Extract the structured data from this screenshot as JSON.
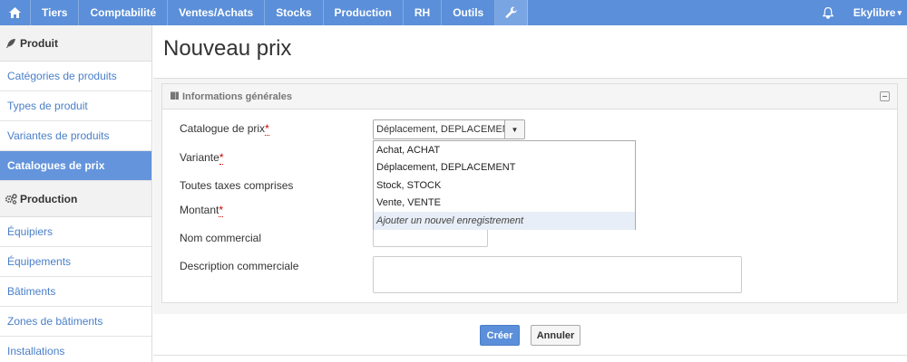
{
  "nav": {
    "home_icon": "home-icon",
    "items": [
      "Tiers",
      "Comptabilité",
      "Ventes/Achats",
      "Stocks",
      "Production",
      "RH",
      "Outils"
    ],
    "settings_icon": "wrench-icon",
    "bell_icon": "bell-icon",
    "user": "Ekylibre",
    "user_caret": "▾"
  },
  "sidebar": {
    "sections": [
      {
        "title": "Produit",
        "icon": "feather-icon",
        "items": [
          "Catégories de produits",
          "Types de produit",
          "Variantes de produits",
          "Catalogues de prix"
        ]
      },
      {
        "title": "Production",
        "icon": "gears-icon",
        "items": [
          "Équipiers",
          "Équipements",
          "Bâtiments",
          "Zones de bâtiments",
          "Installations"
        ]
      }
    ],
    "active_item": "Catalogues de prix"
  },
  "page": {
    "title": "Nouveau prix"
  },
  "panel": {
    "title": "Informations générales",
    "icon": "book-icon",
    "fields": {
      "catalogue": "Catalogue de prix",
      "variante": "Variante",
      "ttc": "Toutes taxes comprises",
      "montant": "Montant",
      "nom_commercial": "Nom commercial",
      "description": "Description commerciale"
    },
    "required_marker": "*",
    "catalogue_value": "Déplacement, DEPLACEMENT",
    "dropdown_options": [
      "Achat, ACHAT",
      "Déplacement, DEPLACEMENT",
      "Stock, STOCK",
      "Vente, VENTE"
    ],
    "add_new_option": "Ajouter un nouvel enregistrement"
  },
  "actions": {
    "create": "Créer",
    "cancel": "Annuler"
  },
  "colors": {
    "nav_bg": "#5b8fd9",
    "active_sidebar": "#6495dc",
    "link": "#4a7fc8"
  }
}
